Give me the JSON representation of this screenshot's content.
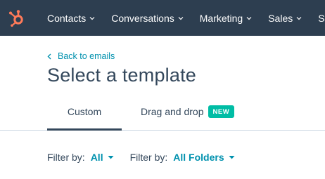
{
  "topnav": {
    "brand_color": "#ff7a59",
    "bg_color": "#2d3e50",
    "items": [
      {
        "label": "Contacts"
      },
      {
        "label": "Conversations"
      },
      {
        "label": "Marketing"
      },
      {
        "label": "Sales"
      },
      {
        "label": "Ser"
      }
    ]
  },
  "back": {
    "label": "Back to emails"
  },
  "page": {
    "title": "Select a template"
  },
  "tabs": [
    {
      "label": "Custom",
      "active": true
    },
    {
      "label": "Drag and drop",
      "badge": "NEW",
      "badge_color": "#00bda5"
    }
  ],
  "filters": [
    {
      "label": "Filter by:",
      "value": "All"
    },
    {
      "label": "Filter by:",
      "value": "All Folders"
    }
  ],
  "accent_color": "#0091ae"
}
